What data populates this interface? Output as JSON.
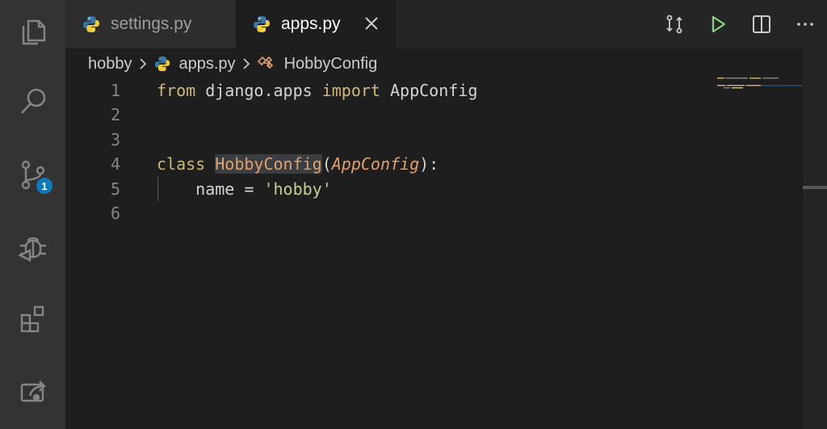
{
  "activity_bar": {
    "items": [
      "explorer",
      "search",
      "source-control",
      "run-debug",
      "extensions",
      "remote-explorer"
    ],
    "scm_badge": "1"
  },
  "tabs": [
    {
      "label": "settings.py",
      "active": false
    },
    {
      "label": "apps.py",
      "active": true
    }
  ],
  "breadcrumb": {
    "folder": "hobby",
    "file": "apps.py",
    "symbol": "HobbyConfig"
  },
  "editor": {
    "line_numbers": [
      "1",
      "2",
      "3",
      "4",
      "5",
      "6"
    ],
    "line1": {
      "kw_from": "from",
      "module": " django.apps ",
      "kw_import": "import",
      "name": " AppConfig"
    },
    "line4": {
      "kw_class": "class",
      "space": " ",
      "class_name": "HobbyConfig",
      "open": "(",
      "base": "AppConfig",
      "close": "):"
    },
    "line5": {
      "indent": "    ",
      "attr": "name = ",
      "value": "'hobby'"
    }
  },
  "colors": {
    "background": "#1e1e1e",
    "activity_bar": "#333333",
    "badge": "#1177bb",
    "run_button": "#89d185",
    "python_blue": "#3b77a8",
    "python_yellow": "#f3c93c"
  }
}
